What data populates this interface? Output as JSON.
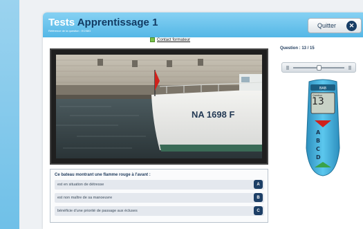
{
  "header": {
    "title_part1": "Tests",
    "title_part2": "Apprentissage 1",
    "subtitle": "Référence de la question : ECS8G",
    "quit_label": "Quitter",
    "quit_icon": "close-icon"
  },
  "contact": {
    "label": "Contact formateur",
    "icon": "contact-icon"
  },
  "photo": {
    "registration": "NA 1698 F"
  },
  "question": {
    "text": "Ce bateau montrant une flamme rouge à l'avant :",
    "answers": [
      {
        "text": "est en situation de détresse",
        "letter": "A"
      },
      {
        "text": "est non maître de sa manoeuvre",
        "letter": "B"
      },
      {
        "text": "bénéficie d'une priorité de passage aux écluses",
        "letter": "C"
      }
    ]
  },
  "progress": {
    "label": "Question : 13 / 15"
  },
  "player": {
    "position": 0.45
  },
  "remote": {
    "brand": "BAB",
    "screen_label": "Question",
    "screen_value": "13",
    "buttons": [
      "A",
      "B",
      "C",
      "D"
    ]
  },
  "colors": {
    "header": "#54b7e6",
    "title_dark": "#123b63",
    "answer_letter_bg": "#1d3f66",
    "remote_body": "#3fb2dc"
  }
}
